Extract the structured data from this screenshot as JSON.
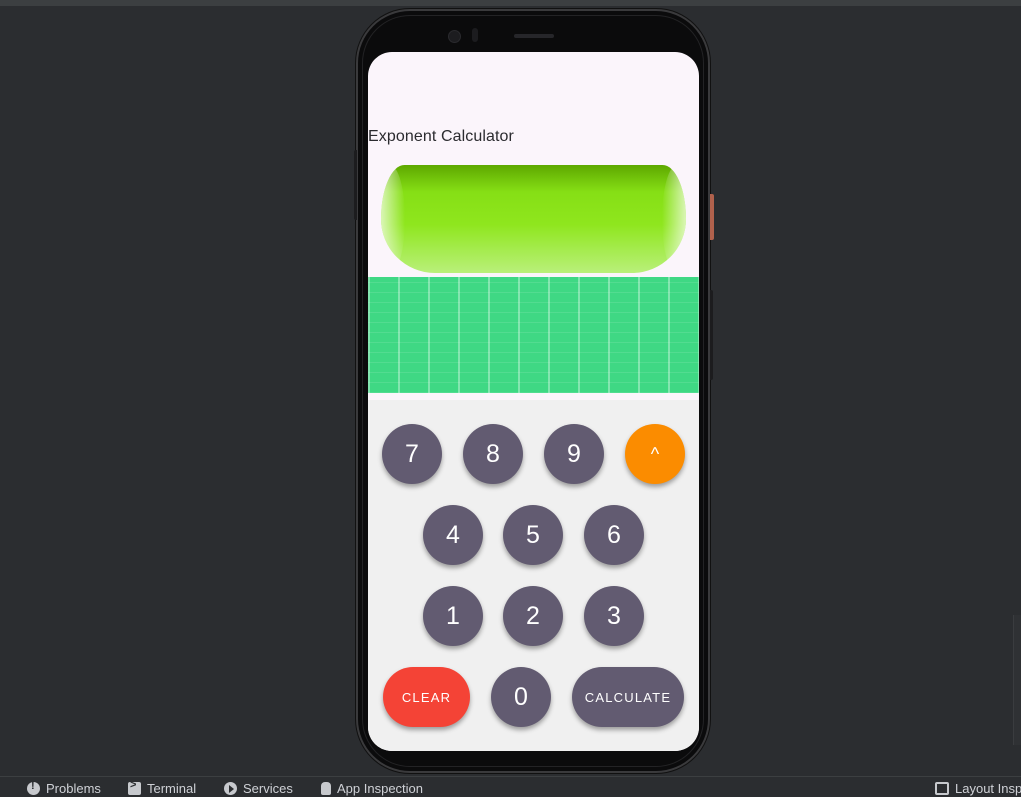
{
  "app": {
    "title": "Exponent Calculator"
  },
  "keypad": {
    "row1": [
      "7",
      "8",
      "9",
      "^"
    ],
    "row2": [
      "4",
      "5",
      "6"
    ],
    "row3": [
      "1",
      "2",
      "3"
    ],
    "row4": {
      "clear": "CLEAR",
      "zero": "0",
      "calculate": "CALCULATE"
    }
  },
  "colors": {
    "key": "#625b71",
    "power_key": "#fb8c00",
    "clear_key": "#f44336",
    "green_image": "#8fe61e",
    "grid_image": "#3fd884"
  },
  "ide_toolbar": {
    "items": [
      {
        "label": "Problems",
        "icon": "problems-icon"
      },
      {
        "label": "Terminal",
        "icon": "terminal-icon"
      },
      {
        "label": "Services",
        "icon": "services-icon"
      },
      {
        "label": "App Inspection",
        "icon": "app-inspection-icon"
      }
    ],
    "right_item": {
      "label": "Layout Insp",
      "icon": "layout-inspector-icon"
    }
  }
}
